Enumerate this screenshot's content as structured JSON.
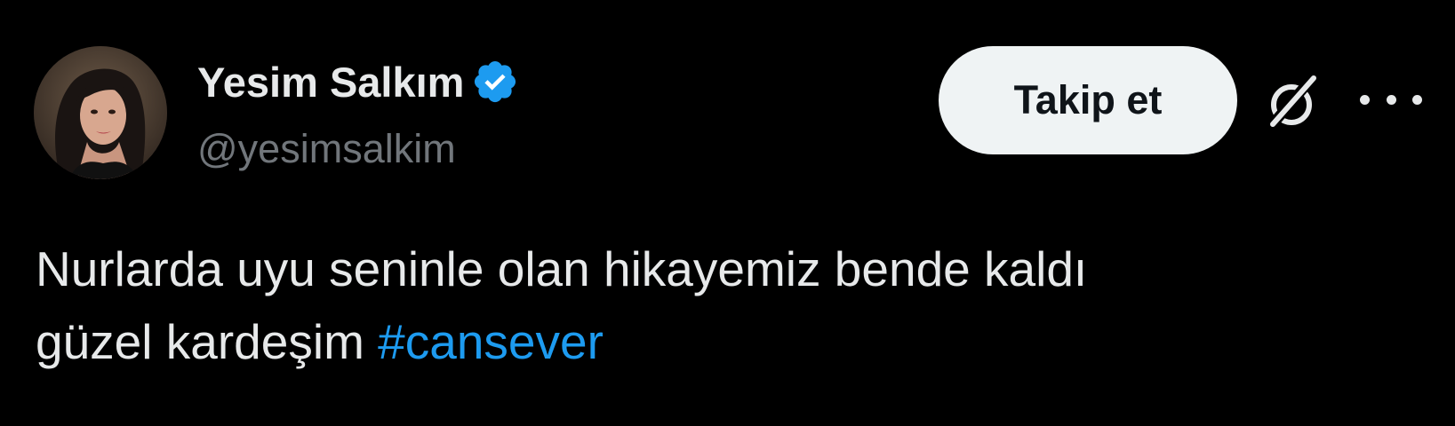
{
  "user": {
    "display_name": "Yesim Salkım",
    "handle": "@yesimsalkim",
    "verified": true
  },
  "actions": {
    "follow_label": "Takip et"
  },
  "tweet": {
    "line1": "Nurlarda uyu seninle olan hikayemiz bende kaldı",
    "line2_text": "güzel kardeşim",
    "hashtag": "#cansever"
  },
  "icons": {
    "verified": "verified-badge-icon",
    "grok": "grok-icon",
    "more": "more-options-icon"
  },
  "colors": {
    "background": "#000000",
    "text_primary": "#e7e9ea",
    "text_secondary": "#71767b",
    "accent": "#1d9bf0",
    "button_bg": "#eff3f4"
  }
}
